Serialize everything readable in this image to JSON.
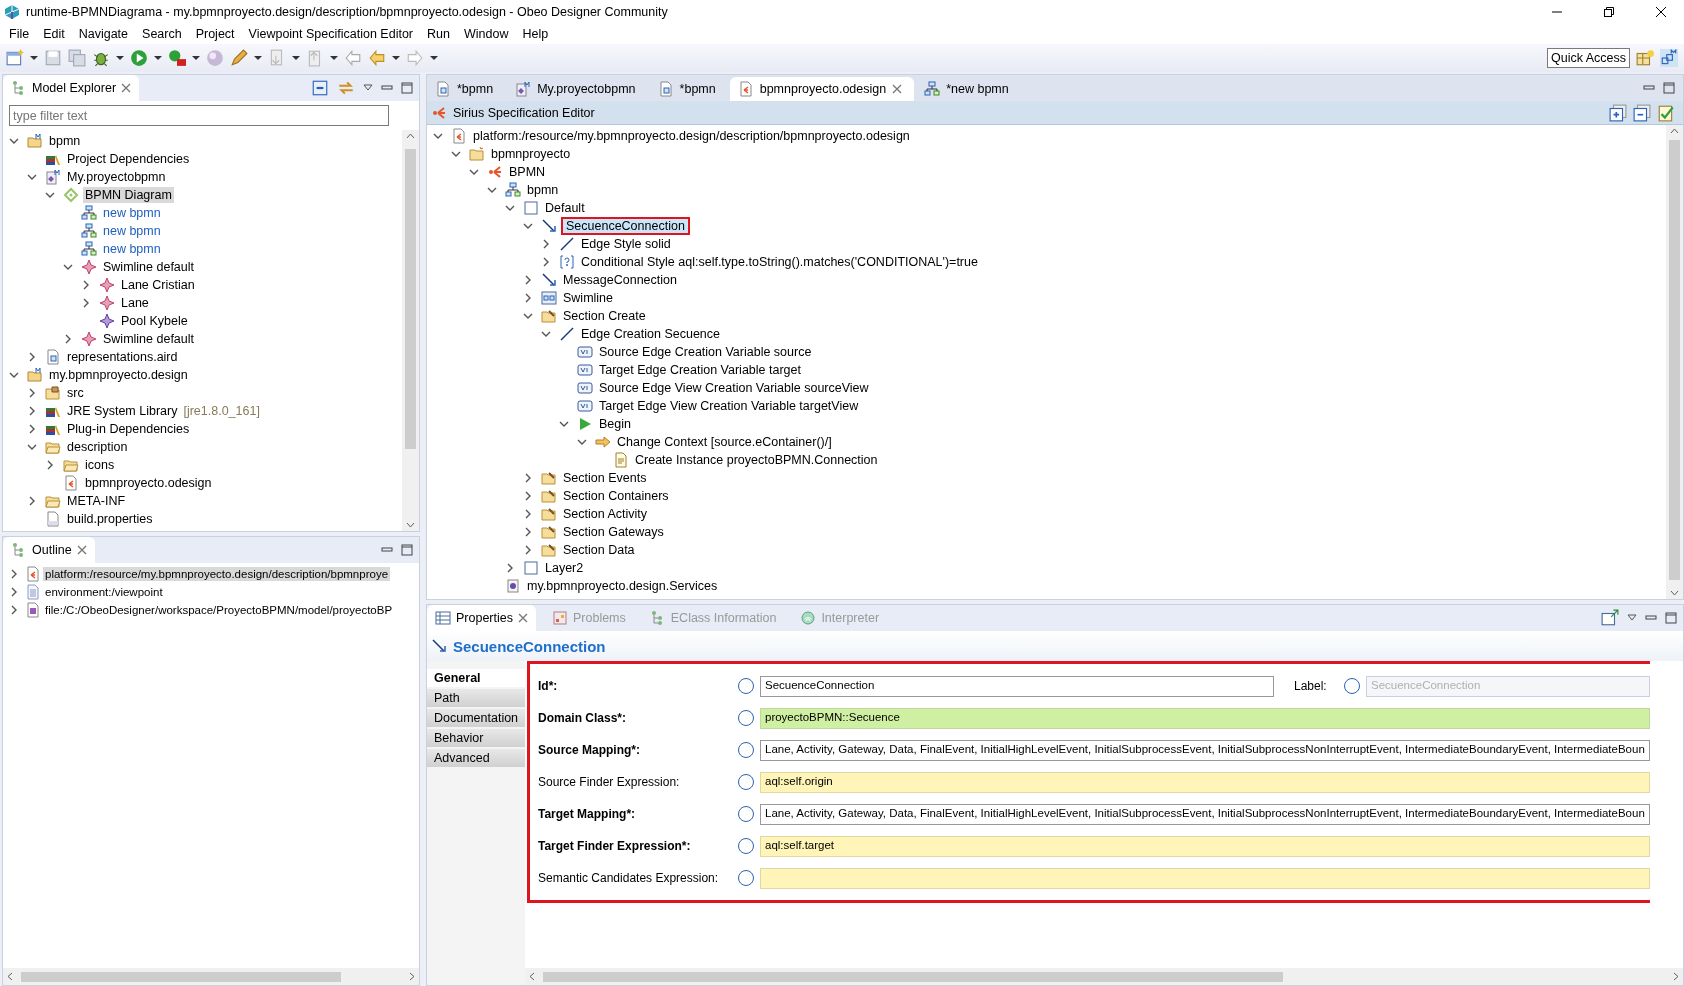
{
  "window": {
    "title": "runtime-BPMNDiagrama - my.bpmnproyecto.design/description/bpmnproyecto.odesign - Obeo Designer Community"
  },
  "menu": [
    "File",
    "Edit",
    "Navigate",
    "Search",
    "Project",
    "Viewpoint Specification Editor",
    "Run",
    "Window",
    "Help"
  ],
  "toolbar": {
    "quick_access": "Quick Access"
  },
  "explorer": {
    "title": "Model Explorer",
    "filter": {
      "placeholder": "type filter text"
    },
    "items": [
      {
        "label": "bpmn",
        "kind": "project",
        "expanded": true,
        "selected": false,
        "children": [
          {
            "label": "Project Dependencies",
            "kind": "library",
            "selected": false
          },
          {
            "label": "My.proyectobpmn",
            "kind": "model",
            "expanded": true,
            "selected": false,
            "children": [
              {
                "label": "BPMN Diagram",
                "kind": "viewpoint",
                "expanded": true,
                "selected": true,
                "children": [
                  {
                    "label": "new bpmn",
                    "kind": "representation",
                    "selected": false
                  },
                  {
                    "label": "new bpmn",
                    "kind": "representation",
                    "selected": false
                  },
                  {
                    "label": "new bpmn",
                    "kind": "representation",
                    "selected": false
                  },
                  {
                    "label": "Swimline default",
                    "kind": "element",
                    "expanded": true,
                    "selected": false,
                    "children": [
                      {
                        "label": "Lane Cristian",
                        "kind": "element",
                        "expanded": false,
                        "selected": false
                      },
                      {
                        "label": "Lane",
                        "kind": "element",
                        "expanded": false,
                        "selected": false
                      },
                      {
                        "label": "Pool Kybele",
                        "kind": "pool",
                        "selected": false
                      }
                    ]
                  },
                  {
                    "label": "Swimline default",
                    "kind": "element",
                    "expanded": false,
                    "selected": false
                  }
                ]
              }
            ]
          },
          {
            "label": "representations.aird",
            "kind": "aird",
            "expanded": false,
            "selected": false
          }
        ]
      },
      {
        "label": "my.bpmnproyecto.design",
        "kind": "project",
        "expanded": true,
        "selected": false,
        "children": [
          {
            "label": "src",
            "kind": "package",
            "expanded": false,
            "selected": false
          },
          {
            "label": "JRE System Library",
            "detail": "[jre1.8.0_161]",
            "kind": "library",
            "expanded": false,
            "selected": false
          },
          {
            "label": "Plug-in Dependencies",
            "kind": "library",
            "expanded": false,
            "selected": false
          },
          {
            "label": "description",
            "kind": "folder",
            "expanded": true,
            "selected": false,
            "children": [
              {
                "label": "icons",
                "kind": "folder",
                "expanded": false,
                "selected": false
              },
              {
                "label": "bpmnproyecto.odesign",
                "kind": "odesign",
                "selected": false
              }
            ]
          },
          {
            "label": "META-INF",
            "kind": "folder",
            "expanded": false,
            "selected": false
          },
          {
            "label": "build.properties",
            "kind": "properties",
            "selected": false
          }
        ]
      }
    ]
  },
  "outline": {
    "title": "Outline",
    "items": [
      {
        "label": "platform:/resource/my.bpmnproyecto.design/description/bpmnproye",
        "kind": "odesign",
        "expanded": false,
        "selected": true
      },
      {
        "label": "environment:/viewpoint",
        "kind": "text",
        "expanded": false,
        "selected": false
      },
      {
        "label": "file:/C:/ObeoDesigner/workspace/ProyectoBPMN/model/proyectoBP",
        "kind": "ecore",
        "expanded": false,
        "selected": false
      }
    ]
  },
  "editor_tabs": [
    {
      "label": "*bpmn",
      "kind": "aird",
      "selected": false
    },
    {
      "label": "My.proyectobpmn",
      "kind": "model",
      "selected": false
    },
    {
      "label": "*bpmn",
      "kind": "aird",
      "selected": false
    },
    {
      "label": "bpmnproyecto.odesign",
      "kind": "odesign",
      "selected": true
    },
    {
      "label": "*new bpmn",
      "kind": "representation",
      "selected": false
    }
  ],
  "editor": {
    "title": "Sirius Specification Editor",
    "items": [
      {
        "label": "platform:/resource/my.bpmnproyecto.design/description/bpmnproyecto.odesign",
        "kind": "odesign",
        "expanded": true,
        "selected": false,
        "children": [
          {
            "label": "bpmnproyecto",
            "kind": "viewpointfolder",
            "expanded": true,
            "selected": false,
            "children": [
              {
                "label": "BPMN",
                "kind": "sirius",
                "expanded": true,
                "selected": false,
                "children": [
                  {
                    "label": "bpmn",
                    "kind": "representation",
                    "expanded": true,
                    "selected": false,
                    "children": [
                      {
                        "label": "Default",
                        "kind": "layer",
                        "expanded": true,
                        "selected": false,
                        "children": [
                          {
                            "label": "SecuenceConnection",
                            "kind": "edge",
                            "expanded": true,
                            "selected": true,
                            "outlined": true,
                            "children": [
                              {
                                "label": "Edge Style solid",
                                "kind": "line",
                                "expanded": false,
                                "selected": false
                              },
                              {
                                "label": "Conditional Style aql:self.type.toString().matches('CONDITIONAL')=true",
                                "kind": "conditional",
                                "expanded": false,
                                "selected": false
                              }
                            ]
                          },
                          {
                            "label": "MessageConnection",
                            "kind": "edge",
                            "expanded": false,
                            "selected": false
                          },
                          {
                            "label": "Swimline",
                            "kind": "container",
                            "expanded": false,
                            "selected": false
                          },
                          {
                            "label": "Section Create",
                            "kind": "section",
                            "expanded": true,
                            "selected": false,
                            "children": [
                              {
                                "label": "Edge Creation Secuence",
                                "kind": "line",
                                "expanded": true,
                                "selected": false,
                                "children": [
                                  {
                                    "label": "Source Edge Creation Variable source",
                                    "kind": "variable",
                                    "selected": false
                                  },
                                  {
                                    "label": "Target Edge Creation Variable target",
                                    "kind": "variable",
                                    "selected": false
                                  },
                                  {
                                    "label": "Source Edge View Creation Variable sourceView",
                                    "kind": "variable",
                                    "selected": false
                                  },
                                  {
                                    "label": "Target Edge View Creation Variable targetView",
                                    "kind": "variable",
                                    "selected": false
                                  },
                                  {
                                    "label": "Begin",
                                    "kind": "begin",
                                    "expanded": true,
                                    "selected": false,
                                    "children": [
                                      {
                                        "label": "Change Context [source.eContainer()/]",
                                        "kind": "context",
                                        "expanded": true,
                                        "selected": false,
                                        "children": [
                                          {
                                            "label": "Create Instance proyectoBPMN.Connection",
                                            "kind": "create",
                                            "selected": false
                                          }
                                        ]
                                      }
                                    ]
                                  }
                                ]
                              }
                            ]
                          },
                          {
                            "label": "Section Events",
                            "kind": "section",
                            "expanded": false,
                            "selected": false
                          },
                          {
                            "label": "Section Containers",
                            "kind": "section",
                            "expanded": false,
                            "selected": false
                          },
                          {
                            "label": "Section Activity",
                            "kind": "section",
                            "expanded": false,
                            "selected": false
                          },
                          {
                            "label": "Section Gateways",
                            "kind": "section",
                            "expanded": false,
                            "selected": false
                          },
                          {
                            "label": "Section Data",
                            "kind": "section",
                            "expanded": false,
                            "selected": false
                          }
                        ]
                      },
                      {
                        "label": "Layer2",
                        "kind": "layer",
                        "expanded": false,
                        "selected": false
                      }
                    ]
                  },
                  {
                    "label": "my.bpmnproyecto.design.Services",
                    "kind": "java",
                    "selected": false
                  }
                ]
              }
            ]
          }
        ]
      }
    ]
  },
  "properties": {
    "tabs": [
      {
        "label": "Properties",
        "kind": "table",
        "selected": true
      },
      {
        "label": "Problems",
        "kind": "problems",
        "selected": false
      },
      {
        "label": "EClass Information",
        "kind": "tree",
        "selected": false
      },
      {
        "label": "Interpreter",
        "kind": "globe",
        "selected": false
      }
    ],
    "title": "SecuenceConnection",
    "sections": [
      {
        "label": "General",
        "selected": true
      },
      {
        "label": "Path",
        "selected": false
      },
      {
        "label": "Documentation",
        "selected": false
      },
      {
        "label": "Behavior",
        "selected": false
      },
      {
        "label": "Advanced",
        "selected": false
      }
    ],
    "form": {
      "outlined": true,
      "fields": [
        {
          "label": "Id*:",
          "required": true,
          "kind": "text",
          "value": "SecuenceConnection",
          "side": {
            "label": "Label:",
            "value": "SecuenceConnection",
            "disabled": true
          }
        },
        {
          "label": "Domain Class*:",
          "required": true,
          "kind": "class",
          "value": "proyectoBPMN::Secuence"
        },
        {
          "label": "Source Mapping*:",
          "required": true,
          "kind": "text",
          "value": "Lane, Activity, Gateway, Data, FinalEvent, InitialHighLevelEvent, InitialSubprocessEvent, InitialSubprocessNonInterruptEvent, IntermediateBoundaryEvent, IntermediateBoun"
        },
        {
          "label": "Source Finder Expression:",
          "required": false,
          "kind": "expression",
          "value": "aql:self.origin"
        },
        {
          "label": "Target Mapping*:",
          "required": true,
          "kind": "text",
          "value": "Lane, Activity, Gateway, Data, FinalEvent, InitialHighLevelEvent, InitialSubprocessEvent, InitialSubprocessNonInterruptEvent, IntermediateBoundaryEvent, IntermediateBoun"
        },
        {
          "label": "Target Finder Expression*:",
          "required": true,
          "kind": "expression",
          "value": "aql:self.target"
        },
        {
          "label": "Semantic Candidates Expression:",
          "required": false,
          "kind": "expression"
        }
      ]
    }
  }
}
